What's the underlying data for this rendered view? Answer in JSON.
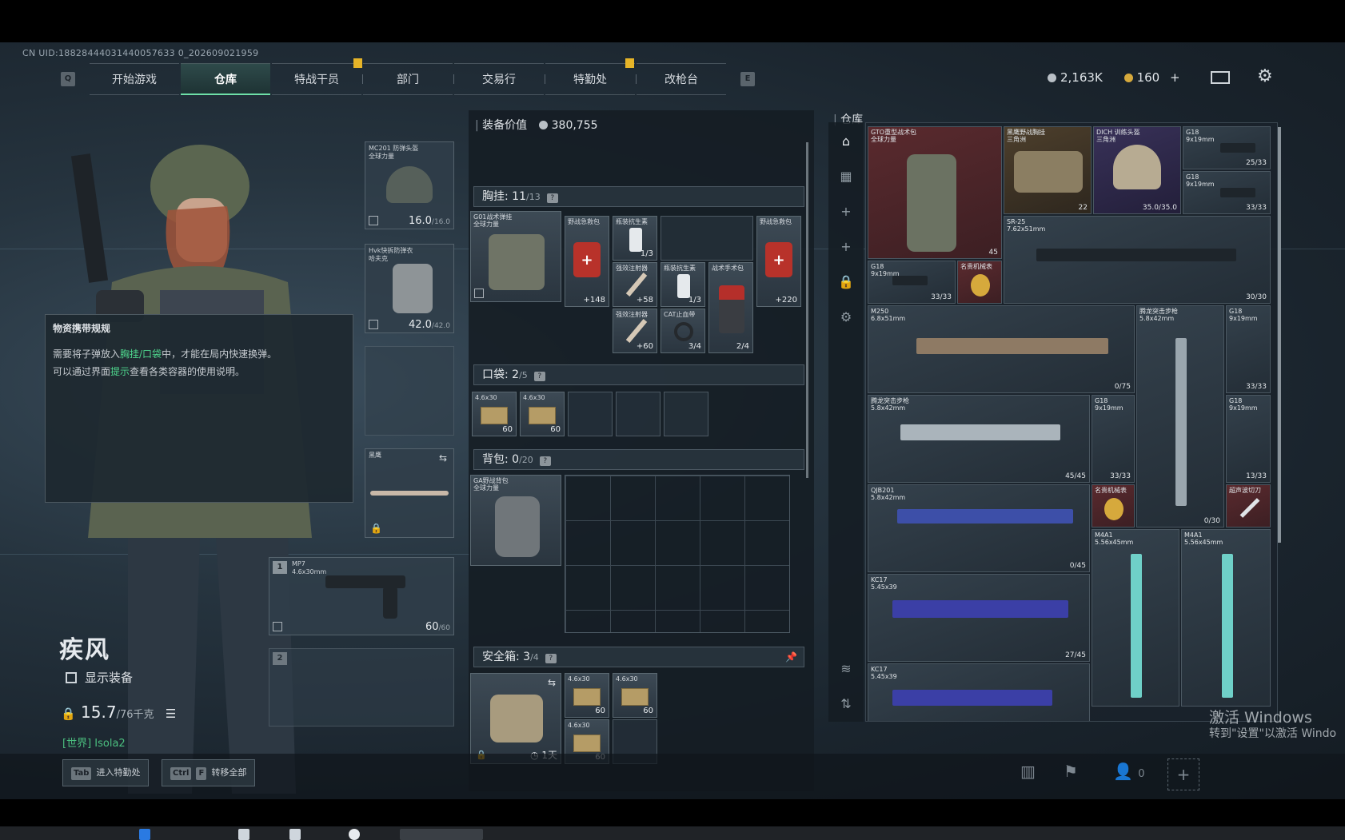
{
  "header": {
    "uid": "CN UID:18828444031440057633 0_202609021959",
    "nav_left_key": "Q",
    "nav_right_key": "E",
    "tabs": [
      "开始游戏",
      "仓库",
      "特战干员",
      "部门",
      "交易行",
      "特勤处",
      "改枪台"
    ],
    "active_tab": "仓库",
    "currency": {
      "silver": "2,163K",
      "gold": "160",
      "gold_plus": "+"
    }
  },
  "hint": {
    "title": "物资携带规规",
    "line1_a": "需要将子弹放入",
    "line1_b": "胸挂/口袋",
    "line1_c": "中，才能在局内快速换弹。",
    "line2_a": "可以通过界面",
    "line2_b": "提示",
    "line2_c": "查看各类容器的使用说明。"
  },
  "player": {
    "name": "疾风",
    "show_equipment": "显示装备",
    "weight": "15.7",
    "weight_max": "/76千克",
    "world_tag": "[世界]",
    "world_name": "Isola2"
  },
  "equipment": {
    "helmet": {
      "name": "MC201 防弹头盔",
      "sub": "全球力量",
      "value": "16.0",
      "max": "/16.0"
    },
    "armor": {
      "name": "Hvk快拆防弹衣",
      "sub": "哈夫克",
      "value": "42.0",
      "max": "/42.0"
    },
    "melee": {
      "name": "黑鹰"
    },
    "primary": {
      "num": "1",
      "name": "MP7",
      "caliber": "4.6x30mm",
      "ammo": "60",
      "ammo_max": "/60"
    },
    "secondary": {
      "num": "2"
    }
  },
  "loadout": {
    "value_label": "装备价值",
    "value": "380,755",
    "chest": {
      "label": "胸挂:",
      "count": "11",
      "max": "/13",
      "help": "?"
    },
    "chest_rig": {
      "name": "G01战术弹挂",
      "sub": "全球力量"
    },
    "chest_items": [
      {
        "name": "野战急救包",
        "count": "+148"
      },
      {
        "name": "瓶装抗生素",
        "count": "1/3"
      },
      {
        "name": "强效注射器",
        "count": "+58"
      },
      {
        "name": "瓶装抗生素",
        "count": "1/3"
      },
      {
        "name": "战术手术包",
        "count": "2/4"
      },
      {
        "name": "强效注射器",
        "count": "+60"
      },
      {
        "name": "CAT止血带",
        "count": "3/4"
      },
      {
        "name": "野战急救包",
        "count": "+220"
      }
    ],
    "pocket": {
      "label": "口袋:",
      "count": "2",
      "max": "/5",
      "help": "?"
    },
    "pocket_items": [
      {
        "name": "4.6x30",
        "count": "60"
      },
      {
        "name": "4.6x30",
        "count": "60"
      }
    ],
    "backpack": {
      "label": "背包:",
      "count": "0",
      "max": "/20",
      "help": "?"
    },
    "backpack_item": {
      "name": "GA野战背包",
      "sub": "全球力量"
    },
    "safe": {
      "label": "安全箱:",
      "count": "3",
      "max": "/4",
      "help": "?",
      "timer": "1天"
    },
    "safe_items": [
      {
        "name": "4.6x30",
        "count": "60"
      },
      {
        "name": "4.6x30",
        "count": "60"
      },
      {
        "name": "4.6x30",
        "count": "60"
      }
    ]
  },
  "storage": {
    "title": "仓库",
    "items": [
      {
        "name": "GTO重型战术包",
        "sub": "全球力量",
        "count": "45"
      },
      {
        "name": "黑鹰野战胸挂",
        "sub": "三角洲",
        "count": "22"
      },
      {
        "name": "DICH 训练头盔",
        "sub": "三角洲",
        "count": "35.0/35.0"
      },
      {
        "name": "G18",
        "sub": "9x19mm",
        "count": "25/33"
      },
      {
        "name": "G18",
        "sub": "9x19mm",
        "count": "33/33"
      },
      {
        "name": "SR-25",
        "sub": "7.62x51mm",
        "count": "30/30"
      },
      {
        "name": "G18",
        "sub": "9x19mm",
        "count": "33/33"
      },
      {
        "name": "名贵机械表",
        "sub": "",
        "count": ""
      },
      {
        "name": "M250",
        "sub": "6.8x51mm",
        "count": "0/75"
      },
      {
        "name": "腾龙突击步枪",
        "sub": "5.8x42mm",
        "count": "0/30"
      },
      {
        "name": "G18",
        "sub": "9x19mm",
        "count": "33/33"
      },
      {
        "name": "腾龙突击步枪",
        "sub": "5.8x42mm",
        "count": "45/45"
      },
      {
        "name": "G18",
        "sub": "9x19mm",
        "count": "33/33"
      },
      {
        "name": "G18",
        "sub": "9x19mm",
        "count": "13/33"
      },
      {
        "name": "QJB201",
        "sub": "5.8x42mm",
        "count": "0/45"
      },
      {
        "name": "名贵机械表",
        "sub": "",
        "count": ""
      },
      {
        "name": "超声波切刀",
        "sub": "",
        "count": ""
      },
      {
        "name": "M4A1",
        "sub": "5.56x45mm",
        "count": ""
      },
      {
        "name": "M4A1",
        "sub": "5.56x45mm",
        "count": ""
      },
      {
        "name": "KC17",
        "sub": "5.45x39",
        "count": "27/45"
      },
      {
        "name": "KC17",
        "sub": "5.45x39",
        "count": ""
      }
    ]
  },
  "bottom": {
    "enter_key": "Tab",
    "enter_label": "进入特勤处",
    "transfer_key1": "Ctrl",
    "transfer_key2": "F",
    "transfer_label": "转移全部",
    "friends": "0"
  },
  "windows": {
    "line1": "激活 Windows",
    "line2": "转到\"设置\"以激活 Windo"
  }
}
